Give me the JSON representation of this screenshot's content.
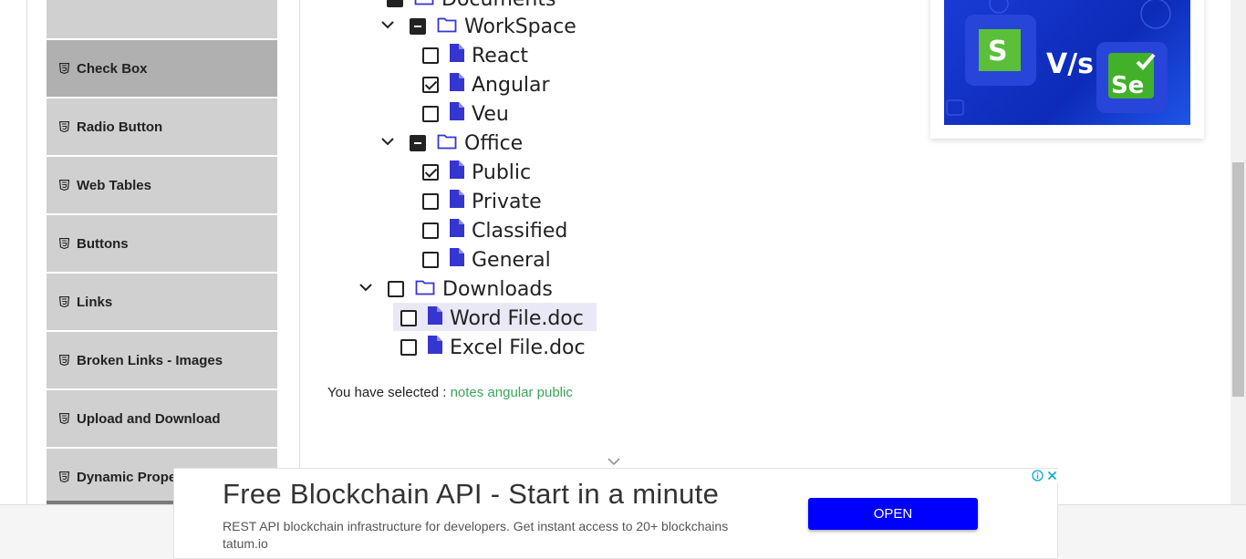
{
  "sidebar": {
    "items": [
      {
        "label": "",
        "active": false
      },
      {
        "label": "Check Box",
        "active": true
      },
      {
        "label": "Radio Button",
        "active": false
      },
      {
        "label": "Web Tables",
        "active": false
      },
      {
        "label": "Buttons",
        "active": false
      },
      {
        "label": "Links",
        "active": false
      },
      {
        "label": "Broken Links - Images",
        "active": false
      },
      {
        "label": "Upload and Download",
        "active": false
      },
      {
        "label": "Dynamic Properties",
        "active": false
      }
    ]
  },
  "tree": {
    "documents": "Documents",
    "workspace": "WorkSpace",
    "react": "React",
    "angular": "Angular",
    "veu": "Veu",
    "office": "Office",
    "public": "Public",
    "private": "Private",
    "classified": "Classified",
    "general": "General",
    "downloads": "Downloads",
    "word": "Word File.doc",
    "excel": "Excel File.doc"
  },
  "result": {
    "prefix": "You have selected :",
    "selected": "notes angular public"
  },
  "ad_banner": {
    "title": "Free Blockchain API - Start in a minute",
    "description": "REST API blockchain infrastructure for developers. Get instant access to 20+ blockchains tatum.io",
    "button": "OPEN"
  },
  "colors": {
    "accent_blue": "#3535d0",
    "selected_green": "#3aa55b",
    "button_blue": "#0000ff"
  },
  "ad_card": {
    "vs_text": "V/s"
  }
}
